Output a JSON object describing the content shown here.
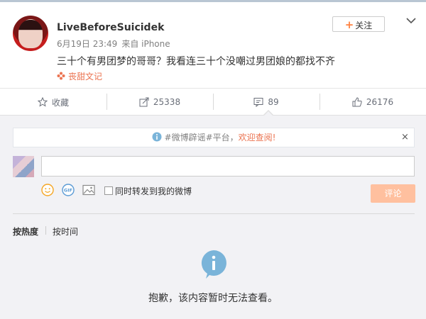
{
  "post": {
    "username": "LiveBeforeSuicidek",
    "date": "6月19日 23:49",
    "source": "来自 iPhone",
    "text": "三十个有男团梦的哥哥？我看连三十个没嘲过男团娘的都找不齐",
    "tag": "丧甜文记",
    "follow_label": "关注",
    "follow_plus": "+"
  },
  "actions": {
    "favorite_label": "收藏",
    "repost_count": "25338",
    "comment_count": "89",
    "like_count": "26176"
  },
  "comments": {
    "notice_text": "#微博辟谣#平台，",
    "notice_link": "欢迎查阅!",
    "notice_close": "×",
    "forward_label": "同时转发到我的微博",
    "submit_label": "评论",
    "sort_hot": "按热度",
    "sort_time": "按时间",
    "empty_message": "抱歉，该内容暂时无法查看。"
  },
  "colors": {
    "accent": "#eb7350",
    "submit_disabled": "#ffc09f",
    "info_blue": "#7ab4d9"
  }
}
